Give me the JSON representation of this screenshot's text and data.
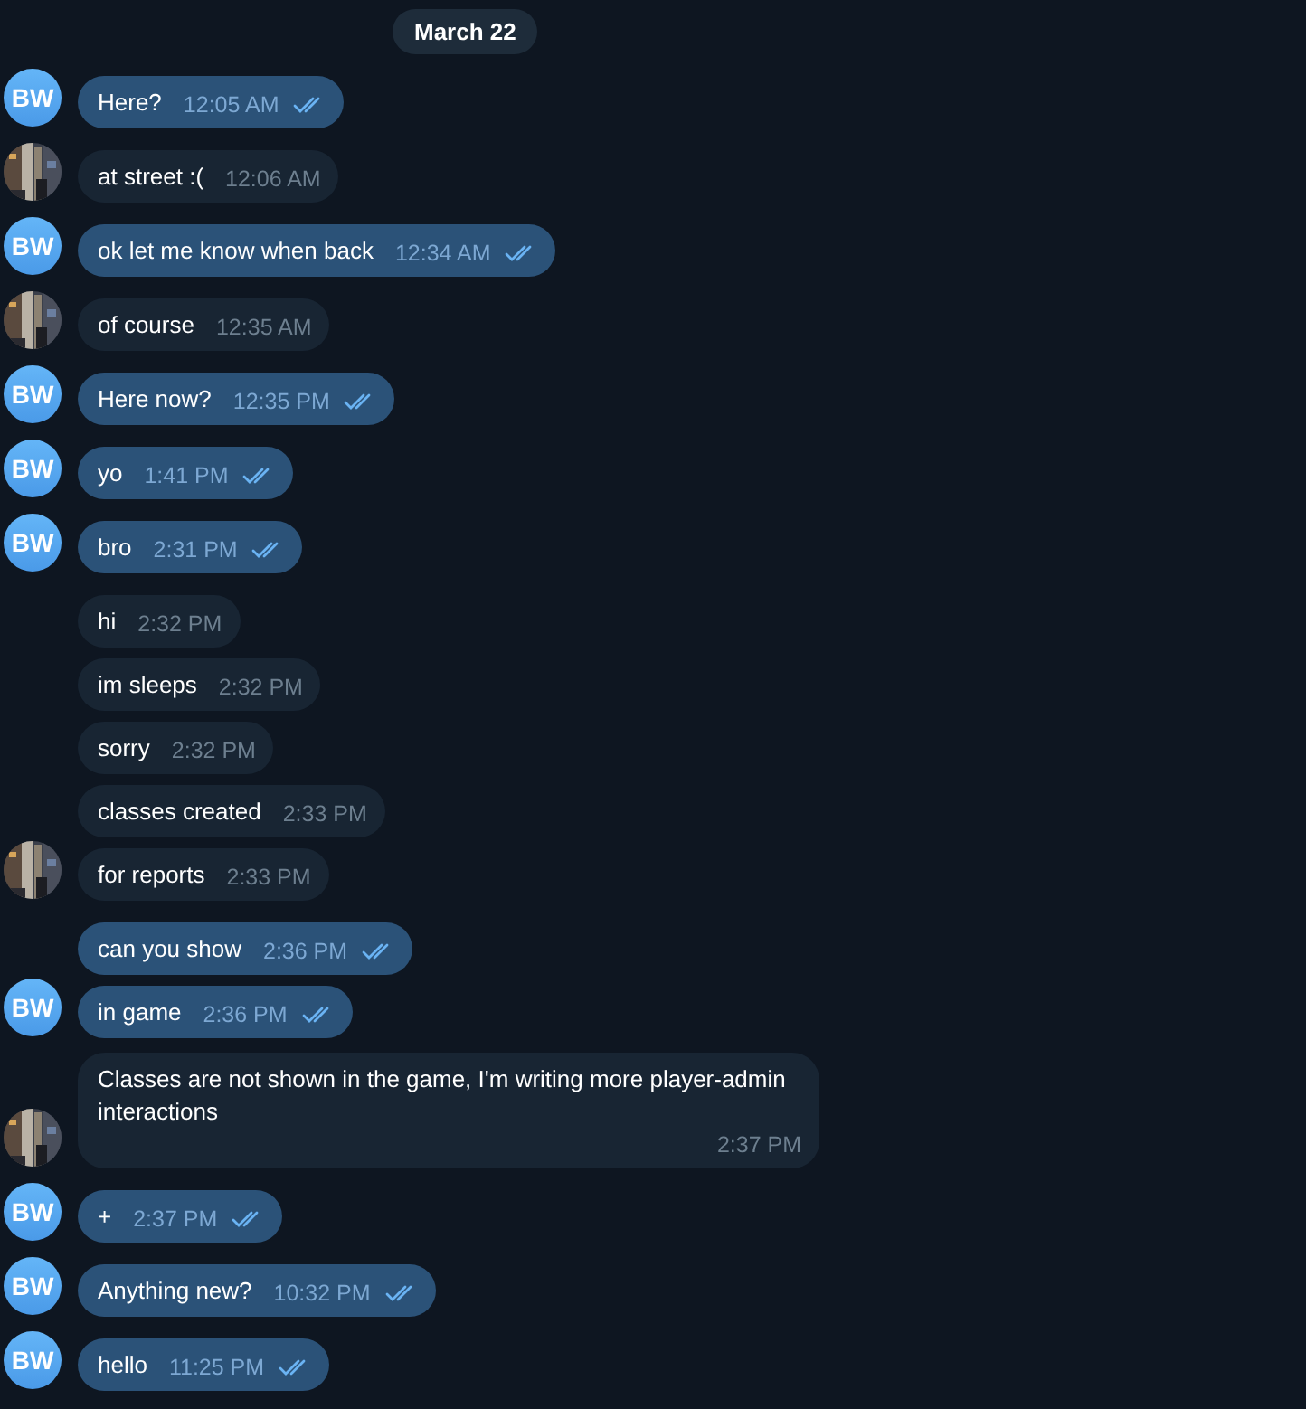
{
  "date_label": "March 22",
  "messages": [
    {
      "kind": "outgoing",
      "avatar": true,
      "initials": "BW",
      "text": "Here?",
      "time": "12:05 AM",
      "read": true
    },
    {
      "kind": "incoming",
      "avatar": true,
      "text": "at street :(",
      "time": "12:06 AM"
    },
    {
      "kind": "outgoing",
      "avatar": true,
      "initials": "BW",
      "text": "ok let me know when back",
      "time": "12:34 AM",
      "read": true
    },
    {
      "kind": "incoming",
      "avatar": true,
      "text": "of course",
      "time": "12:35 AM"
    },
    {
      "kind": "outgoing",
      "avatar": true,
      "initials": "BW",
      "text": "Here now?",
      "time": "12:35 PM",
      "read": true
    },
    {
      "kind": "outgoing",
      "avatar": true,
      "initials": "BW",
      "text": "yo",
      "time": "1:41 PM",
      "read": true
    },
    {
      "kind": "outgoing",
      "avatar": true,
      "initials": "BW",
      "text": "bro",
      "time": "2:31 PM",
      "read": true
    },
    {
      "kind": "incoming",
      "avatar": false,
      "text": "hi",
      "time": "2:32 PM"
    },
    {
      "kind": "incoming",
      "avatar": false,
      "text": "im sleeps",
      "time": "2:32 PM"
    },
    {
      "kind": "incoming",
      "avatar": false,
      "text": "sorry",
      "time": "2:32 PM"
    },
    {
      "kind": "incoming",
      "avatar": false,
      "text": "classes created",
      "time": "2:33 PM"
    },
    {
      "kind": "incoming",
      "avatar": true,
      "text": "for reports",
      "time": "2:33 PM"
    },
    {
      "kind": "outgoing",
      "avatar": false,
      "text": "can you show",
      "time": "2:36 PM",
      "read": true
    },
    {
      "kind": "outgoing",
      "avatar": true,
      "initials": "BW",
      "text": "in game",
      "time": "2:36 PM",
      "read": true
    },
    {
      "kind": "incoming",
      "avatar": true,
      "text": "Classes are not shown in the game, I'm writing more player-admin interactions",
      "time": "2:37 PM"
    },
    {
      "kind": "outgoing",
      "avatar": true,
      "initials": "BW",
      "text": "+",
      "time": "2:37 PM",
      "read": true
    },
    {
      "kind": "outgoing",
      "avatar": true,
      "initials": "BW",
      "text": "Anything new?",
      "time": "10:32 PM",
      "read": true
    },
    {
      "kind": "outgoing",
      "avatar": true,
      "initials": "BW",
      "text": "hello",
      "time": "11:25 PM",
      "read": true
    }
  ]
}
